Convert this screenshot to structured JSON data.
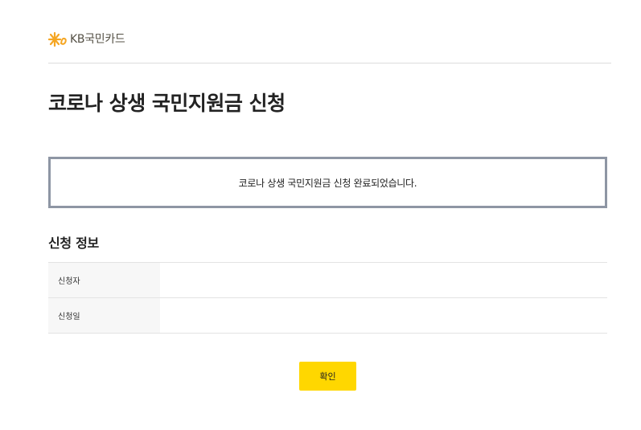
{
  "brand": {
    "logo_text": "KB국민카드",
    "accent_color": "#f5a623"
  },
  "page": {
    "title": "코로나 상생 국민지원금 신청"
  },
  "notice": {
    "message": "코로나 상생 국민지원금 신청 완료되었습니다."
  },
  "info_section": {
    "title": "신청 정보",
    "rows": [
      {
        "label": "신청자",
        "value": ""
      },
      {
        "label": "신청일",
        "value": ""
      }
    ]
  },
  "actions": {
    "confirm_label": "확인",
    "confirm_color": "#ffd700"
  }
}
